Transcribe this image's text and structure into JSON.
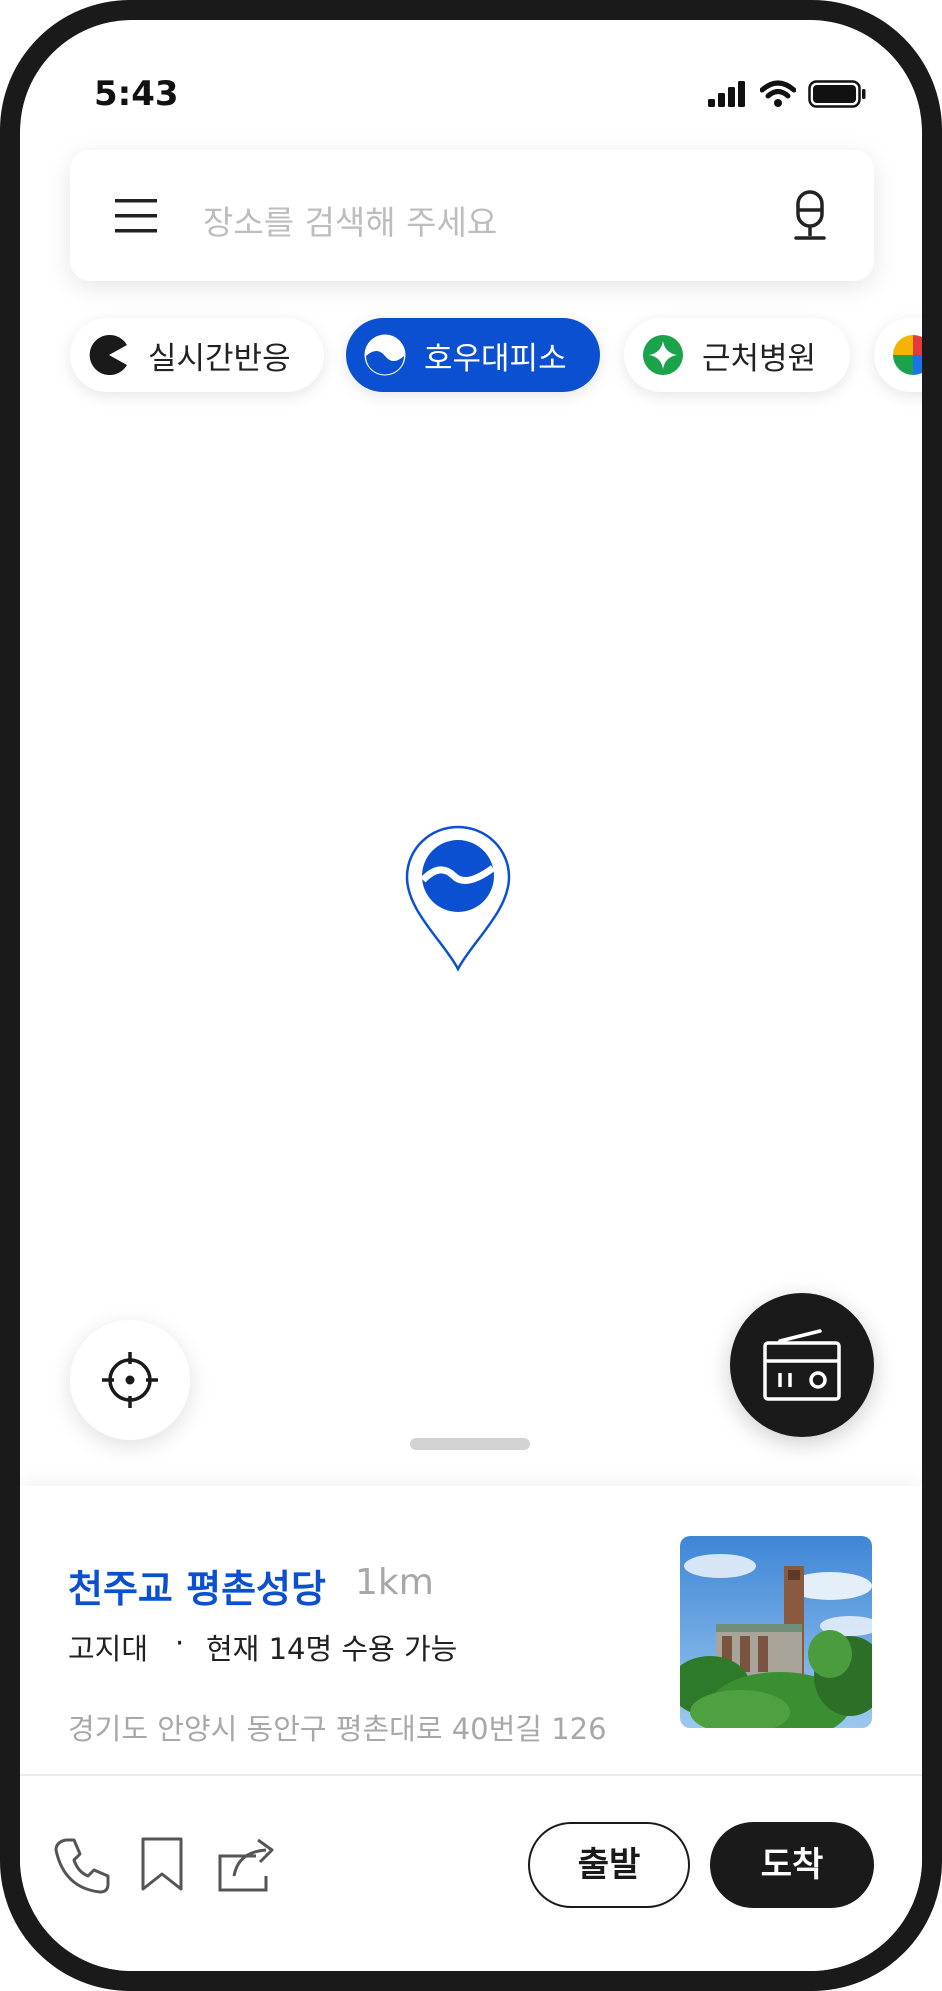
{
  "status_bar": {
    "time": "5:43"
  },
  "search": {
    "placeholder": "장소를 검색해 주세요"
  },
  "chips": [
    {
      "label": "실시간반응",
      "icon": "pacman-icon",
      "active": false
    },
    {
      "label": "호우대피소",
      "icon": "shelter-icon",
      "active": true
    },
    {
      "label": "근처병원",
      "icon": "hospital-icon",
      "active": false
    },
    {
      "label": "",
      "icon": "multicolor-category-icon",
      "active": false
    }
  ],
  "place": {
    "name": "천주교 평촌성당",
    "distance": "1km",
    "tag": "고지대",
    "separator": "·",
    "capacity": "현재 14명 수용 가능",
    "address": "경기도 안양시 동안구 평촌대로 40번길 126"
  },
  "actions": {
    "depart_label": "출발",
    "arrive_label": "도착"
  },
  "colors": {
    "accent": "#0a50d0",
    "dark": "#1a1a1a",
    "muted": "#a8a8a8",
    "hospital": "#1aa34a"
  }
}
